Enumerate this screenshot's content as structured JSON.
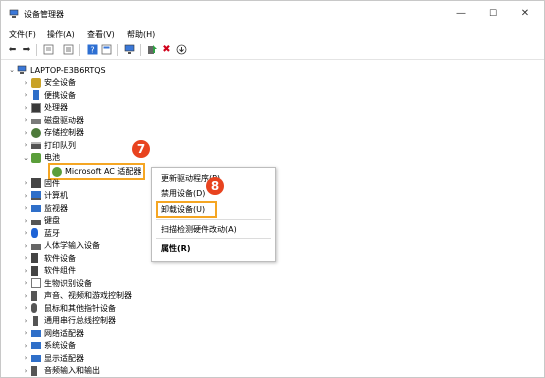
{
  "window": {
    "title": "设备管理器",
    "controls": {
      "minimize": "—",
      "maximize": "☐",
      "close": "✕"
    }
  },
  "menubar": {
    "items": [
      "文件(F)",
      "操作(A)",
      "查看(V)",
      "帮助(H)"
    ]
  },
  "toolbar": {
    "icons": [
      "back-icon",
      "forward-icon",
      "properties-sheet-icon",
      "view-list-icon",
      "help-icon",
      "view-details-icon",
      "monitor-icon",
      "update-driver-icon",
      "uninstall-x-icon",
      "scan-down-icon"
    ]
  },
  "tree": {
    "root": "LAPTOP-E3B6RTQS",
    "items": [
      {
        "label": "安全设备",
        "icon": "security-device-icon",
        "color": "#c9a227"
      },
      {
        "label": "便携设备",
        "icon": "portable-device-icon",
        "color": "#2f6fc9"
      },
      {
        "label": "处理器",
        "icon": "processor-icon",
        "color": "#3a3a3a"
      },
      {
        "label": "磁盘驱动器",
        "icon": "disk-drive-icon",
        "color": "#7a7a7a"
      },
      {
        "label": "存储控制器",
        "icon": "storage-controller-icon",
        "color": "#4d7a3a"
      },
      {
        "label": "打印队列",
        "icon": "print-queue-icon",
        "color": "#555555"
      },
      {
        "label": "电池",
        "icon": "battery-icon",
        "color": "#5a9e3a",
        "expanded": true
      },
      {
        "label": "Microsoft AC 适配器",
        "icon": "ac-adapter-icon",
        "color": "#5a9e3a",
        "child": true
      },
      {
        "label": "固件",
        "icon": "firmware-icon",
        "color": "#444444"
      },
      {
        "label": "计算机",
        "icon": "computer-icon",
        "color": "#2f6fc9"
      },
      {
        "label": "监视器",
        "icon": "monitor-device-icon",
        "color": "#2f6fc9"
      },
      {
        "label": "键盘",
        "icon": "keyboard-icon",
        "color": "#555555"
      },
      {
        "label": "蓝牙",
        "icon": "bluetooth-icon",
        "color": "#1e63d6"
      },
      {
        "label": "人体学输入设备",
        "icon": "hid-icon",
        "color": "#666666"
      },
      {
        "label": "软件设备",
        "icon": "software-device-icon",
        "color": "#444444"
      },
      {
        "label": "软件组件",
        "icon": "software-component-icon",
        "color": "#444444"
      },
      {
        "label": "生物识别设备",
        "icon": "biometric-icon",
        "color": "#777777"
      },
      {
        "label": "声音、视频和游戏控制器",
        "icon": "sound-icon",
        "color": "#555555"
      },
      {
        "label": "鼠标和其他指针设备",
        "icon": "mouse-icon",
        "color": "#555555"
      },
      {
        "label": "通用串行总线控制器",
        "icon": "usb-icon",
        "color": "#555555"
      },
      {
        "label": "网络适配器",
        "icon": "network-adapter-icon",
        "color": "#2f6fc9"
      },
      {
        "label": "系统设备",
        "icon": "system-device-icon",
        "color": "#2f6fc9"
      },
      {
        "label": "显示适配器",
        "icon": "display-adapter-icon",
        "color": "#2f6fc9"
      },
      {
        "label": "音频输入和输出",
        "icon": "audio-io-icon",
        "color": "#555555"
      }
    ]
  },
  "annotations": {
    "step1": "7",
    "step2": "8",
    "highlight_color": "#f5a623",
    "badge_color": "#e8431f"
  },
  "context_menu": {
    "items": [
      "更新驱动程序(P)",
      "禁用设备(D)",
      "卸载设备(U)",
      "扫描检测硬件改动(A)",
      "属性(R)"
    ]
  }
}
